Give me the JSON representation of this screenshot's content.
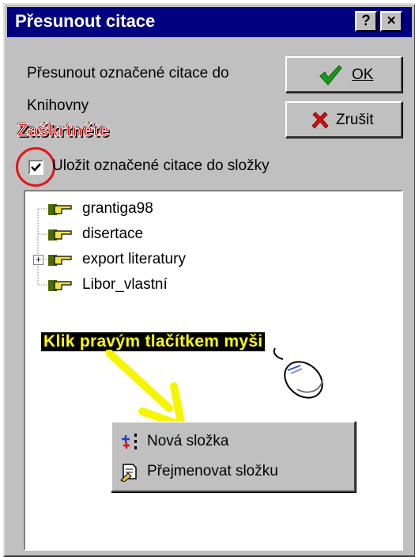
{
  "window": {
    "title": "Přesunout citace",
    "help_button": "?",
    "close_button": "×"
  },
  "message": {
    "line1": "Přesunout označené citace do",
    "line2": "Knihovny"
  },
  "buttons": {
    "ok_label": "OK",
    "cancel_label": "Zrušit"
  },
  "annotations": {
    "check_hint": "Zaškrtněte",
    "right_click_hint": "Klik pravým tlačítkem myši"
  },
  "checkbox": {
    "label": "Uložit označené citace do složky",
    "checked": true
  },
  "tree": {
    "items": [
      {
        "label": "grantiga98",
        "expandable": false
      },
      {
        "label": "disertace",
        "expandable": false
      },
      {
        "label": "export literatury",
        "expandable": true
      },
      {
        "label": "Libor_vlastní",
        "expandable": false
      }
    ]
  },
  "context_menu": {
    "items": [
      {
        "label": "Nová složka",
        "icon": "new-folder-icon"
      },
      {
        "label": "Přejmenovat složku",
        "icon": "rename-folder-icon"
      }
    ]
  },
  "colors": {
    "titlebar": "#000080",
    "face": "#c0c0c0",
    "annotation_red": "#ff1010",
    "annotation_yellow": "#ffff00",
    "ok_check": "#1a9a1a",
    "cancel_x": "#d01010"
  }
}
